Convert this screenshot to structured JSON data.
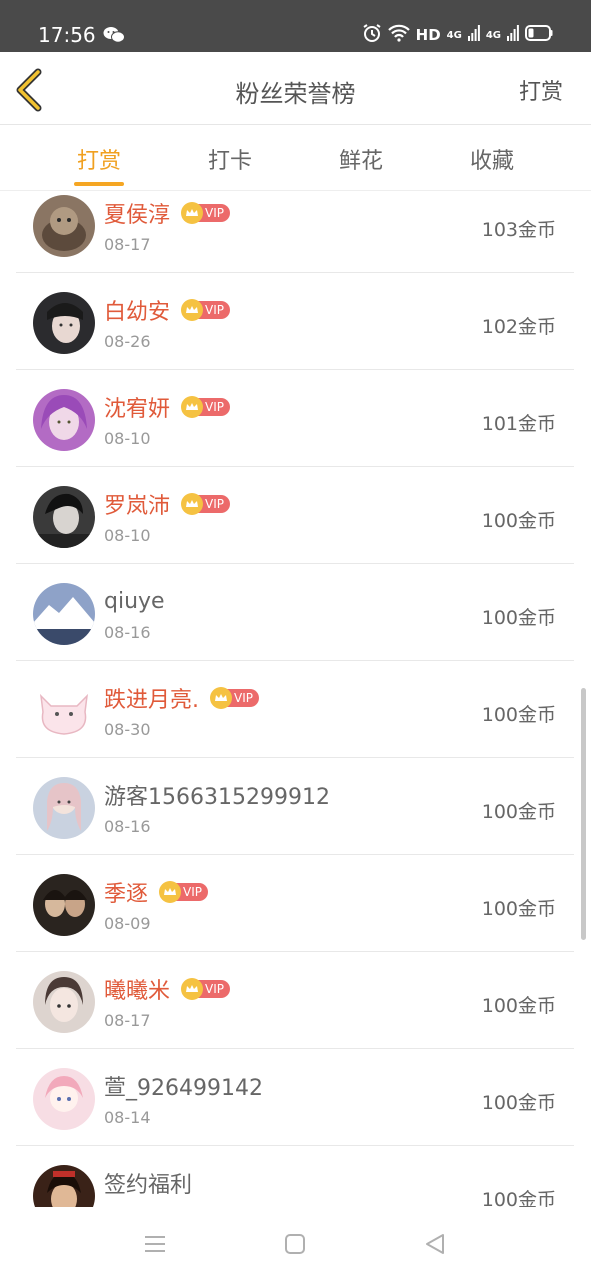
{
  "status_bar": {
    "time": "17:56",
    "network_label": "HD",
    "signal_1": "4G",
    "signal_2": "4G"
  },
  "header": {
    "title": "粉丝荣誉榜",
    "action_label": "打赏"
  },
  "tabs": [
    {
      "label": "打赏",
      "active": true
    },
    {
      "label": "打卡",
      "active": false
    },
    {
      "label": "鲜花",
      "active": false
    },
    {
      "label": "收藏",
      "active": false
    }
  ],
  "vip_label": "VIP",
  "list": [
    {
      "name": "夏侯淳",
      "vip": true,
      "date": "08-17",
      "amount": "103金币"
    },
    {
      "name": "白幼安",
      "vip": true,
      "date": "08-26",
      "amount": "102金币"
    },
    {
      "name": "沈宥妍",
      "vip": true,
      "date": "08-10",
      "amount": "101金币"
    },
    {
      "name": "罗岚沛",
      "vip": true,
      "date": "08-10",
      "amount": "100金币"
    },
    {
      "name": "qiuye",
      "vip": false,
      "date": "08-16",
      "amount": "100金币"
    },
    {
      "name": "跌进月亮.",
      "vip": true,
      "date": "08-30",
      "amount": "100金币"
    },
    {
      "name": "游客1566315299912",
      "vip": false,
      "date": "08-16",
      "amount": "100金币"
    },
    {
      "name": "季逐",
      "vip": true,
      "date": "08-09",
      "amount": "100金币"
    },
    {
      "name": "曦曦米",
      "vip": true,
      "date": "08-17",
      "amount": "100金币"
    },
    {
      "name": "萱_926499142",
      "vip": false,
      "date": "08-14",
      "amount": "100金币"
    },
    {
      "name": "签约福利",
      "vip": false,
      "date": "",
      "amount": "100金币"
    }
  ],
  "colors": {
    "accent": "#f5a623",
    "vip_name": "#e05a3a",
    "vip_badge": "#ec6a6a",
    "status_bar": "#4a4a4a"
  }
}
